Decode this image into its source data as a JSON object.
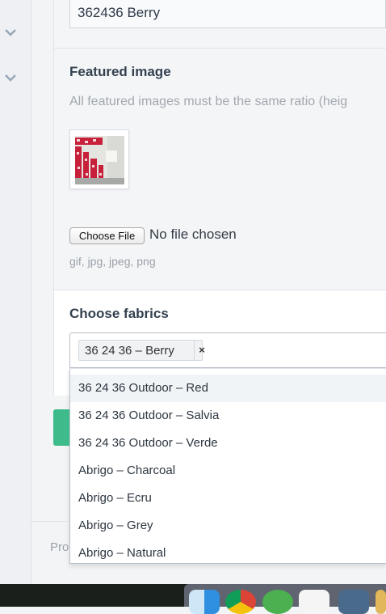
{
  "name_field": {
    "value": "362436 Berry"
  },
  "featured_image": {
    "heading": "Featured image",
    "hint": "All featured images must be the same ratio (heig",
    "thumbnail_icon": "curtain-photo-icon"
  },
  "file_input": {
    "button_label": "Choose File",
    "status": "No file chosen",
    "allowed_types": "gif, jpg, jpeg, png"
  },
  "fabrics": {
    "heading": "Choose fabrics",
    "selected_tags": [
      {
        "label": "36 24 36 – Berry",
        "remove_glyph": "×"
      }
    ],
    "options": [
      {
        "label": "36 24 36 Outdoor – Red",
        "highlighted": true
      },
      {
        "label": "36 24 36 Outdoor – Salvia",
        "highlighted": false
      },
      {
        "label": "36 24 36 Outdoor – Verde",
        "highlighted": false
      },
      {
        "label": "Abrigo – Charcoal",
        "highlighted": false
      },
      {
        "label": "Abrigo – Ecru",
        "highlighted": false
      },
      {
        "label": "Abrigo – Grey",
        "highlighted": false
      },
      {
        "label": "Abrigo – Natural",
        "highlighted": false
      }
    ]
  },
  "footer": {
    "text": "Pro"
  },
  "colors": {
    "accent_green": "#3dbb8b",
    "heading": "#33414f",
    "hint": "#a2a8af"
  },
  "sidebar": {
    "icons": [
      "chevron-down-icon",
      "chevron-down-icon"
    ]
  },
  "dock": {
    "icons": [
      "finder-icon",
      "chrome-icon",
      "android-studio-icon",
      "sketch-icon",
      "xcode-icon",
      "app-icon"
    ]
  }
}
